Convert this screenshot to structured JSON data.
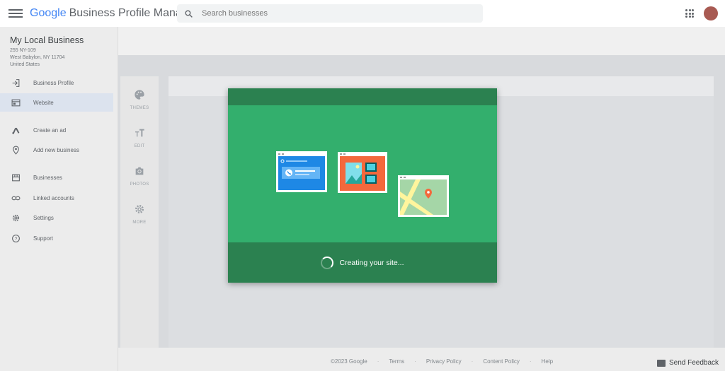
{
  "app": {
    "brand_google": "Google",
    "brand_product": "Business Profile Manager",
    "search_placeholder": "Search businesses"
  },
  "business": {
    "name": "My Local Business",
    "address_line1": "255 NY-109",
    "address_line2": "West Babylon, NY 11704",
    "address_line3": "United States"
  },
  "sidebar": {
    "items": [
      {
        "label": "Business Profile",
        "icon": "sign-in-icon"
      },
      {
        "label": "Website",
        "icon": "website-icon",
        "active": true
      },
      {
        "label": "Create an ad",
        "icon": "google-ads-icon"
      },
      {
        "label": "Add new business",
        "icon": "location-pin-icon"
      },
      {
        "label": "Businesses",
        "icon": "storefront-icon"
      },
      {
        "label": "Linked accounts",
        "icon": "link-icon"
      },
      {
        "label": "Settings",
        "icon": "gear-icon"
      },
      {
        "label": "Support",
        "icon": "help-icon"
      }
    ]
  },
  "tools": [
    {
      "label": "THEMES",
      "icon": "palette-icon"
    },
    {
      "label": "EDIT",
      "icon": "text-format-icon"
    },
    {
      "label": "PHOTOS",
      "icon": "camera-icon"
    },
    {
      "label": "MORE",
      "icon": "gear-icon"
    }
  ],
  "modal": {
    "status": "Creating your site..."
  },
  "footer": {
    "copyright": "©2023 Google",
    "terms": "Terms",
    "privacy": "Privacy Policy",
    "content_policy": "Content Policy",
    "help": "Help",
    "feedback": "Send Feedback"
  },
  "colors": {
    "modal_header": "#2b8150",
    "modal_body": "#33af6d",
    "accent_blue": "#1e88e5",
    "accent_orange": "#f4683c"
  }
}
